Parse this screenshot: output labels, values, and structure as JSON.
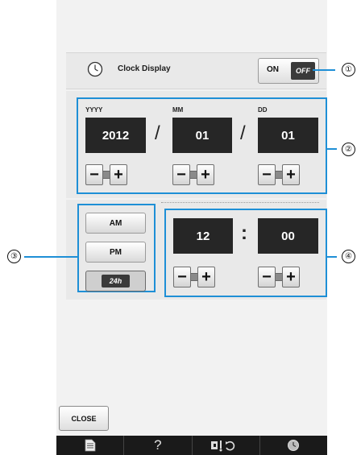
{
  "clock_display": {
    "icon": "clock-icon",
    "label": "Clock Display",
    "toggle_on": "ON",
    "toggle_off": "OFF",
    "state": "off"
  },
  "date": {
    "year_label": "YYYY",
    "month_label": "MM",
    "day_label": "DD",
    "year": "2012",
    "month": "01",
    "day": "01",
    "separator": "/"
  },
  "time": {
    "hour": "12",
    "minute": "00",
    "separator": ":"
  },
  "time_mode": {
    "options": [
      "AM",
      "PM",
      "24h"
    ],
    "selected": "24h"
  },
  "stepper": {
    "minus": "−",
    "plus": "+"
  },
  "callouts": [
    "①",
    "②",
    "③",
    "④"
  ],
  "close_button": "CLOSE",
  "bottom_nav": {
    "items": [
      "document-icon",
      "help-icon",
      "machine-settings-icon",
      "clock-icon"
    ],
    "help_label": "?"
  },
  "colors": {
    "callout_blue": "#1e8fd6",
    "value_box": "#262626",
    "panel": "#e9e9e9",
    "bottom_bar": "#1a1a1a"
  }
}
